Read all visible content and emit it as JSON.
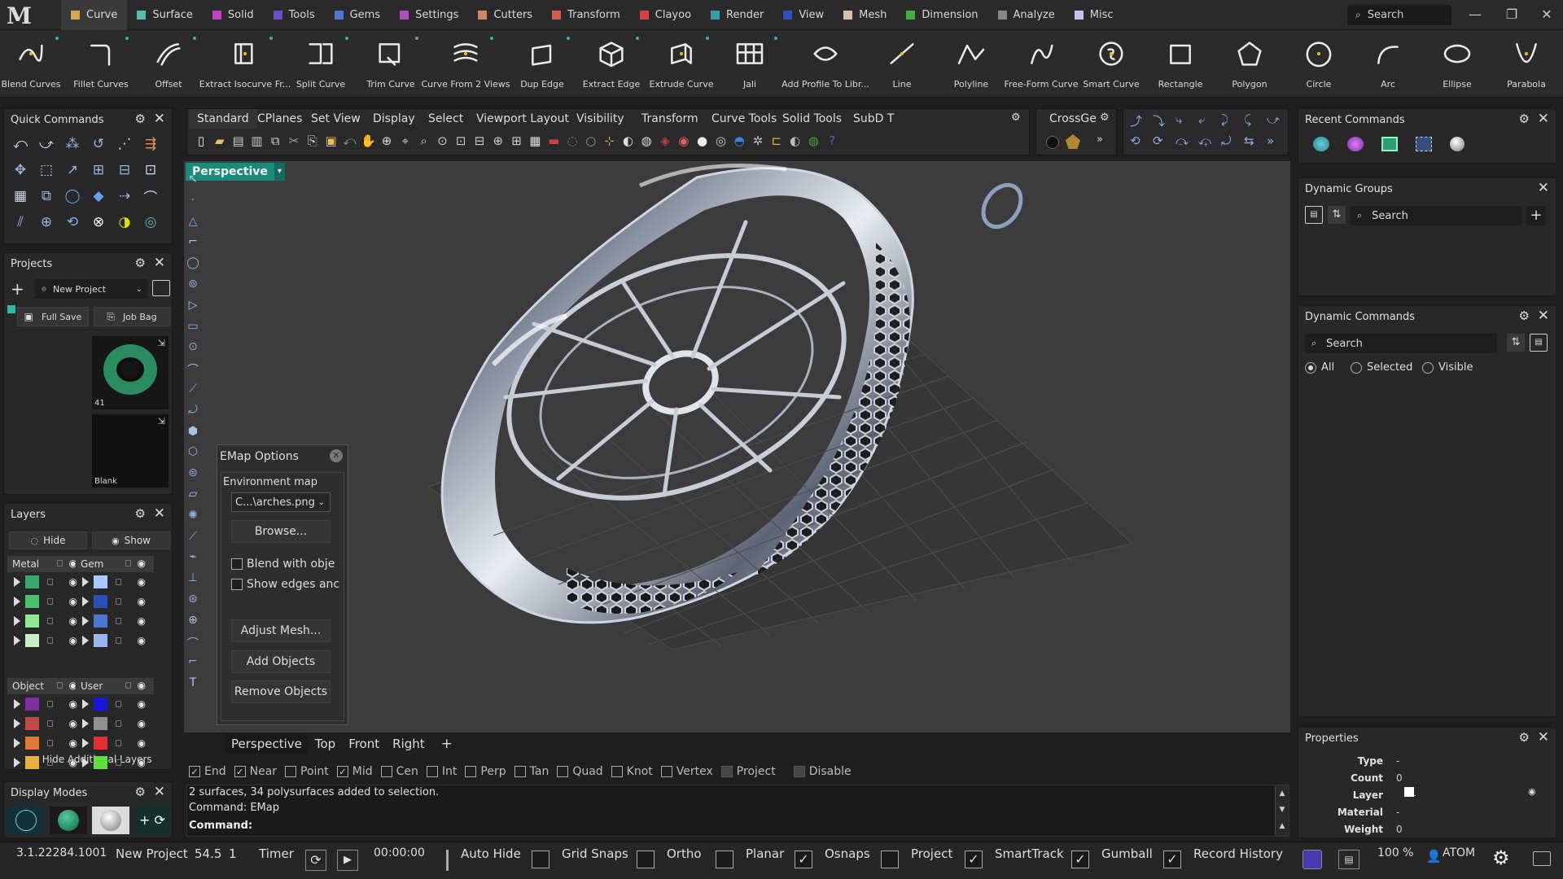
{
  "menu": [
    {
      "label": "Curve",
      "color": "#d6a84b",
      "active": true
    },
    {
      "label": "Surface",
      "color": "#4fc0b0"
    },
    {
      "label": "Solid",
      "color": "#c040c0"
    },
    {
      "label": "Tools",
      "color": "#6a50c8"
    },
    {
      "label": "Gems",
      "color": "#4a78d8"
    },
    {
      "label": "Settings",
      "color": "#b050c0"
    },
    {
      "label": "Cutters",
      "color": "#d08860"
    },
    {
      "label": "Transform",
      "color": "#d85a4a"
    },
    {
      "label": "Clayoo",
      "color": "#d84040"
    },
    {
      "label": "Render",
      "color": "#30a0a8"
    },
    {
      "label": "View",
      "color": "#3050c0"
    },
    {
      "label": "Mesh",
      "color": "#d8c0a8"
    },
    {
      "label": "Dimension",
      "color": "#40b040"
    },
    {
      "label": "Analyze",
      "color": "#888888"
    },
    {
      "label": "Misc",
      "color": "#c8c0f0"
    }
  ],
  "search_label": "Search",
  "ribbon": [
    "Blend Curves",
    "Fillet Curves",
    "Offset",
    "Extract Isocurve Fr...",
    "Split Curve",
    "Trim Curve",
    "Curve From 2 Views",
    "Dup Edge",
    "Extract Edge",
    "Extrude Curve",
    "Jali",
    "Add Profile To Libr...",
    "Line",
    "Polyline",
    "Free-Form Curve",
    "Smart Curve",
    "Rectangle",
    "Polygon",
    "Circle",
    "Arc",
    "Ellipse",
    "Parabola"
  ],
  "quick_commands": {
    "title": "Quick Commands"
  },
  "projects": {
    "title": "Projects",
    "project_name": "New Project",
    "full_save": "Full Save",
    "job_bag": "Job Bag",
    "thumb1": "41",
    "thumb2": "Blank"
  },
  "layers": {
    "title": "Layers",
    "hide": "Hide",
    "show": "Show",
    "groups": [
      {
        "name": "Metal",
        "swatches": [
          "#3aa86a",
          "#4cc070",
          "#90e890",
          "#c8f0c8"
        ]
      },
      {
        "name": "Gem",
        "swatches": [
          "#a8c8ff",
          "#2850b8",
          "#4878d0",
          "#9ab8f0"
        ]
      },
      {
        "name": "Object",
        "swatches": [
          "#8030a0",
          "#c04848",
          "#e07838",
          "#e8b040"
        ]
      },
      {
        "name": "User",
        "swatches": [
          "#1818d8",
          "#909090",
          "#e03030",
          "#60e040"
        ]
      }
    ],
    "more": "Hide Additional Layers"
  },
  "display_modes": {
    "title": "Display Modes"
  },
  "toolbar_tabs": [
    "Standard",
    "CPlanes",
    "Set View",
    "Display",
    "Select",
    "Viewport Layout",
    "Visibility",
    "Transform",
    "Curve Tools",
    "Solid Tools",
    "SubD T"
  ],
  "cross_tab": "CrossGe",
  "viewport": {
    "label": "Perspective",
    "tabs": [
      "Perspective",
      "Top",
      "Front",
      "Right"
    ],
    "add": "+"
  },
  "emap": {
    "title": "EMap Options",
    "section": "Environment map",
    "file": "C...\\arches.png",
    "browse": "Browse...",
    "blend": "Blend with obje",
    "show_edges": "Show edges anc",
    "adjust": "Adjust Mesh...",
    "add": "Add Objects",
    "remove": "Remove Objects"
  },
  "osnaps": [
    {
      "label": "End",
      "checked": true
    },
    {
      "label": "Near",
      "checked": true
    },
    {
      "label": "Point",
      "checked": false
    },
    {
      "label": "Mid",
      "checked": true
    },
    {
      "label": "Cen",
      "checked": false
    },
    {
      "label": "Int",
      "checked": false
    },
    {
      "label": "Perp",
      "checked": false
    },
    {
      "label": "Tan",
      "checked": false
    },
    {
      "label": "Quad",
      "checked": false
    },
    {
      "label": "Knot",
      "checked": false
    },
    {
      "label": "Vertex",
      "checked": false
    },
    {
      "label": "Project",
      "checked": false
    },
    {
      "label": "Disable",
      "checked": false
    }
  ],
  "command": {
    "line1": "2 surfaces, 34 polysurfaces added to selection.",
    "line2": "Command: EMap",
    "prompt": "Command:"
  },
  "statusbar": {
    "version": "3.1.22284.1001",
    "project": "New Project",
    "val1": "54.5",
    "val2": "1",
    "timer": "Timer",
    "time": "00:00:00",
    "autohide": "Auto Hide",
    "gridsnaps": "Grid Snaps",
    "ortho": "Ortho",
    "planar": "Planar",
    "osnaps": "Osnaps",
    "project2": "Project",
    "smarttrack": "SmartTrack",
    "gumball": "Gumball",
    "record": "Record History",
    "zoom": "100 %",
    "user": "ATOM"
  },
  "recent": {
    "title": "Recent Commands"
  },
  "dyn_groups": {
    "title": "Dynamic Groups",
    "search": "Search"
  },
  "dyn_commands": {
    "title": "Dynamic Commands",
    "search": "Search",
    "all": "All",
    "selected": "Selected",
    "visible": "Visible"
  },
  "properties": {
    "title": "Properties",
    "rows": [
      {
        "k": "Type",
        "v": "-"
      },
      {
        "k": "Count",
        "v": "0"
      },
      {
        "k": "Layer",
        "v": "-"
      },
      {
        "k": "Material",
        "v": "-"
      },
      {
        "k": "Weight",
        "v": "0"
      }
    ]
  }
}
